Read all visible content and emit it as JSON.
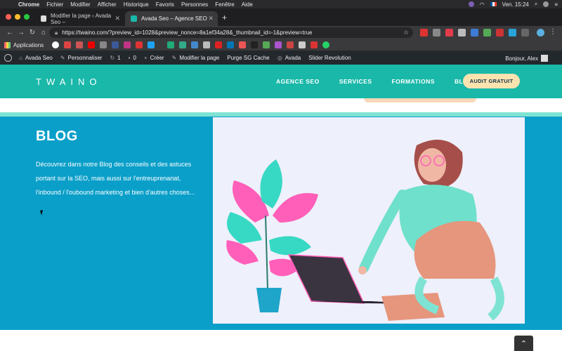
{
  "menubar": {
    "app": "Chrome",
    "items": [
      "Fichier",
      "Modifier",
      "Afficher",
      "Historique",
      "Favoris",
      "Personnes",
      "Fenêtre",
      "Aide"
    ],
    "clock": "Ven. 15:24"
  },
  "tabs": [
    {
      "title": "Modifier la page ‹ Avada Seo –",
      "active": false
    },
    {
      "title": "Avada Seo – Agence SEO",
      "active": true
    }
  ],
  "address": {
    "url": "https://twaino.com/?preview_id=1028&preview_nonce=8a1ef34a28&_thumbnail_id=-1&preview=true"
  },
  "bookmarks": {
    "apps_label": "Applications"
  },
  "wpbar": {
    "site": "Avada Seo",
    "customize": "Personnaliser",
    "updates": "1",
    "comments": "0",
    "new": "Créer",
    "edit": "Modifier la page",
    "purge": "Purge SG Cache",
    "avada": "Avada",
    "slider": "Slider Revolution",
    "greeting": "Bonjour, Alex"
  },
  "site": {
    "logo": "TWAINO",
    "nav": [
      "AGENCE SEO",
      "SERVICES",
      "FORMATIONS",
      "BLOG"
    ],
    "cta": "AUDIT GRATUIT"
  },
  "blog": {
    "title": "BLOG",
    "description": "Découvrez dans notre Blog des conseils et des astuces portant sur la SEO, mais aussi sur l'entreuprenariat, l'inbound / l'oubound marketing et bien d'autres choses..."
  },
  "colors": {
    "header_teal": "#19b8a9",
    "band_blue": "#0a9fc9",
    "cta_bg": "#fbe3b0",
    "strip_teal": "#7fe3d3"
  }
}
